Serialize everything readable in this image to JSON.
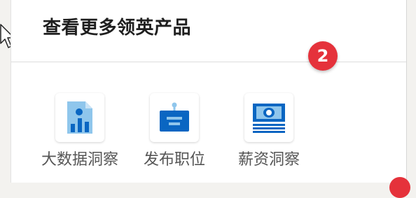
{
  "panel": {
    "title": "查看更多领英产品"
  },
  "badge": {
    "number": "2",
    "color": "#e5323b"
  },
  "products": [
    {
      "label": "大数据洞察",
      "icon": "data-insights-icon"
    },
    {
      "label": "发布职位",
      "icon": "post-job-icon"
    },
    {
      "label": "薪资洞察",
      "icon": "salary-insights-icon"
    }
  ],
  "colors": {
    "icon_blue": "#0a66c2",
    "icon_light_blue": "#8fc6ec"
  }
}
